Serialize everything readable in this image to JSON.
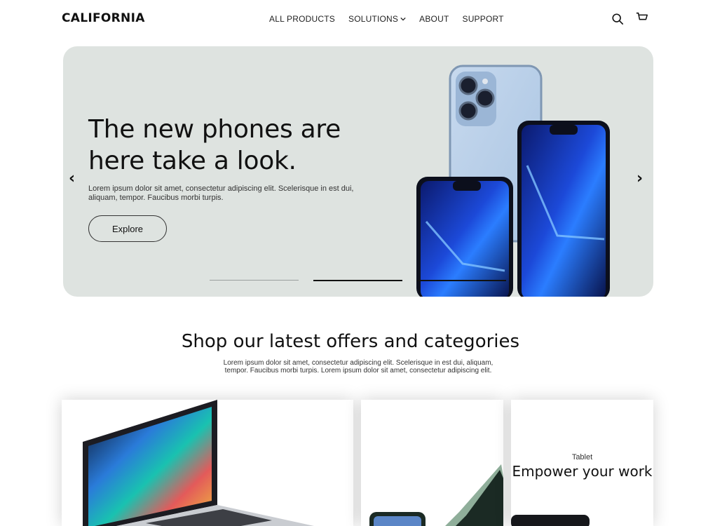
{
  "brand": {
    "logo": "CALIFORNIA"
  },
  "nav": {
    "items": [
      {
        "label": "ALL PRODUCTS"
      },
      {
        "label": "SOLUTIONS"
      },
      {
        "label": "ABOUT"
      },
      {
        "label": "SUPPORT"
      }
    ]
  },
  "header_icons": {
    "search": "search-icon",
    "cart": "cart-icon"
  },
  "hero": {
    "title": "The new phones are here take a look.",
    "text": "Lorem ipsum dolor sit amet, consectetur adipiscing elit. Scelerisque in est dui, aliquam, tempor. Faucibus morbi turpis.",
    "button_label": "Explore",
    "prev_arrow": "‹",
    "next_arrow": "›",
    "background": "#dee3e0"
  },
  "section": {
    "title": "Shop our latest offers and categories",
    "text": "Lorem ipsum dolor sit amet, consectetur adipiscing elit. Scelerisque in est dui, aliquam, tempor. Faucibus morbi turpis. Lorem ipsum dolor sit amet, consectetur adipiscing elit."
  },
  "cards": [
    {
      "image": "laptop"
    },
    {
      "image": "phones"
    },
    {
      "label": "Tablet",
      "title": "Empower your work"
    }
  ]
}
